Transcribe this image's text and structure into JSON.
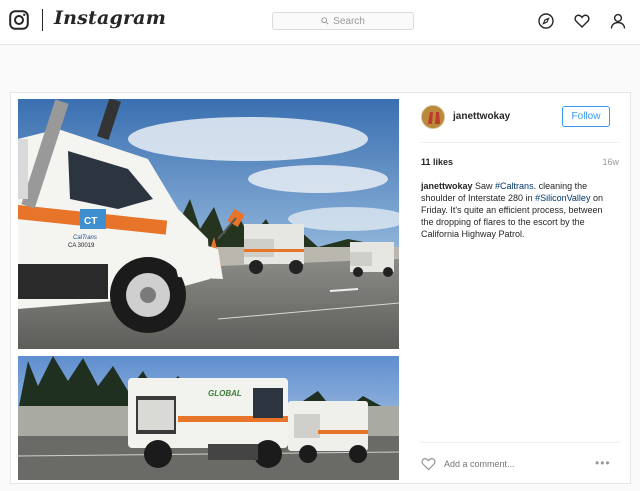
{
  "nav": {
    "brand": "Instagram",
    "search_placeholder": "Search",
    "icons": [
      "camera-icon",
      "search-icon",
      "compass-icon",
      "heart-icon",
      "profile-icon"
    ]
  },
  "post": {
    "username": "janettwokay",
    "follow_label": "Follow",
    "likes": "11 likes",
    "age": "16w",
    "caption": {
      "username": "janettwokay",
      "t1": " Saw ",
      "tag1": "#Caltrans",
      "t2": ". cleaning the shoulder of Interstate 280 in ",
      "tag2": "#SiliconValley",
      "t3": " on Friday. It's quite an efficient process, between the dropping of flares to the escort by the California Highway Patrol."
    },
    "comment_placeholder": "Add a comment...",
    "more_label": "•••",
    "truck_text": {
      "logo": "CT",
      "district": "CalTrans",
      "unit": "CA 30019",
      "sweeper_brand": "GLOBAL"
    }
  },
  "colors": {
    "accent": "#3897f0",
    "hashtag": "#003569",
    "caltrans_orange": "#e8742a"
  }
}
